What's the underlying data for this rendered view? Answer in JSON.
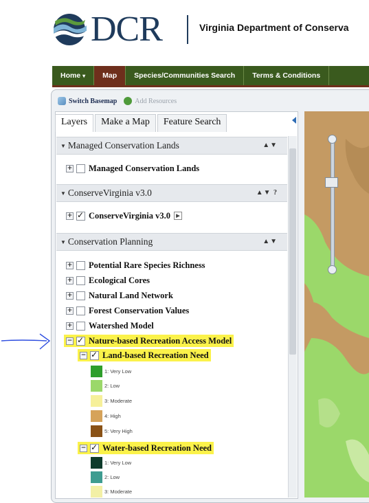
{
  "header": {
    "logo_text": "DCR",
    "agency_name": "Virginia Department of Conserva"
  },
  "nav": {
    "items": [
      {
        "label": "Home",
        "active": false
      },
      {
        "label": "Map",
        "active": true
      },
      {
        "label": "Species/Communities Search",
        "active": false
      },
      {
        "label": "Terms & Conditions",
        "active": false
      }
    ]
  },
  "toolbar": {
    "switch_basemap": "Switch Basemap",
    "add_resources": "Add Resources"
  },
  "tabs": {
    "layers": "Layers",
    "make_a_map": "Make a Map",
    "feature_search": "Feature Search"
  },
  "groups": {
    "managed": {
      "title": "Managed Conservation Lands",
      "controls": "▲▼",
      "layer": "Managed Conservation Lands"
    },
    "conservevirginia": {
      "title": "ConserveVirginia v3.0",
      "controls": "▲▼ ?",
      "layer": "ConserveVirginia v3.0"
    },
    "planning": {
      "title": "Conservation Planning",
      "controls": "▲▼",
      "layers": [
        "Potential Rare Species Richness",
        "Ecological Cores",
        "Natural Land Network",
        "Forest Conservation Values",
        "Watershed Model"
      ],
      "nature_model": "Nature-based Recreation Access Model",
      "land_need": "Land-based Recreation Need",
      "land_legend": [
        {
          "label": "1: Very Low",
          "color": "#2e9e2b"
        },
        {
          "label": "2: Low",
          "color": "#9bd86a"
        },
        {
          "label": "3: Moderate",
          "color": "#f6f09a"
        },
        {
          "label": "4: High",
          "color": "#d6a35a"
        },
        {
          "label": "5: Very High",
          "color": "#8a5216"
        }
      ],
      "water_need": "Water-based Recreation Need",
      "water_legend": [
        {
          "label": "1: Very Low",
          "color": "#0e3b2c"
        },
        {
          "label": "2: Low",
          "color": "#3e9c90"
        },
        {
          "label": "3: Moderate",
          "color": "#f3f0a6"
        }
      ]
    }
  },
  "colors": {
    "nav_bg": "#3a5a1e",
    "nav_active": "#6e2f1c",
    "highlight": "#fbf24a",
    "annotation": "#2d4de0",
    "map_tan": "#c59a63",
    "map_green": "#9bd86a"
  }
}
